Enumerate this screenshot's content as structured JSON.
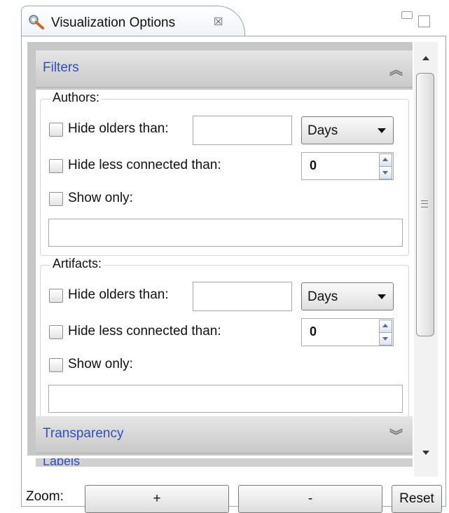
{
  "view": {
    "title": "Visualization Options",
    "icon": "wrench-tool-icon",
    "close_glyph": "☒"
  },
  "filters": {
    "header": "Filters",
    "authors": {
      "title": "Authors:",
      "hide_older_label": "Hide olders than:",
      "hide_older_value": "",
      "unit": "Days",
      "hide_less_label": "Hide less connected than:",
      "hide_less_value": "0",
      "show_only_label": "Show only:",
      "show_only_value": ""
    },
    "artifacts": {
      "title": "Artifacts:",
      "hide_older_label": "Hide olders than:",
      "hide_older_value": "",
      "unit": "Days",
      "hide_less_label": "Hide less connected than:",
      "hide_less_value": "0",
      "show_only_label": "Show only:",
      "show_only_value": ""
    }
  },
  "sections": {
    "transparency": "Transparency",
    "labels": "Labels"
  },
  "zoom": {
    "label": "Zoom:",
    "plus": "+",
    "minus": "-",
    "reset": "Reset"
  },
  "colors": {
    "section_title": "#2f4fc0",
    "panel_bg": "#c7c7c7",
    "border": "#9aa6b4"
  }
}
